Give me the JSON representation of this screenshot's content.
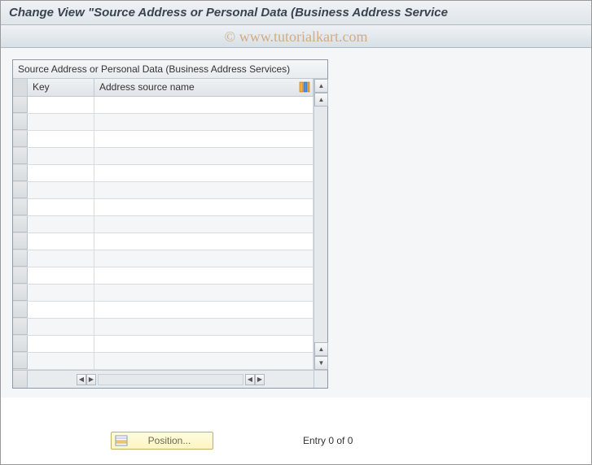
{
  "header": {
    "title": "Change View \"Source Address or Personal Data (Business Address Service"
  },
  "table": {
    "caption": "Source Address or Personal Data (Business Address Services)",
    "columns": {
      "key": "Key",
      "name": "Address source name"
    },
    "row_count": 16
  },
  "footer": {
    "position_label": "Position...",
    "entry_text": "Entry 0 of 0"
  },
  "watermark": "© www.tutorialkart.com"
}
